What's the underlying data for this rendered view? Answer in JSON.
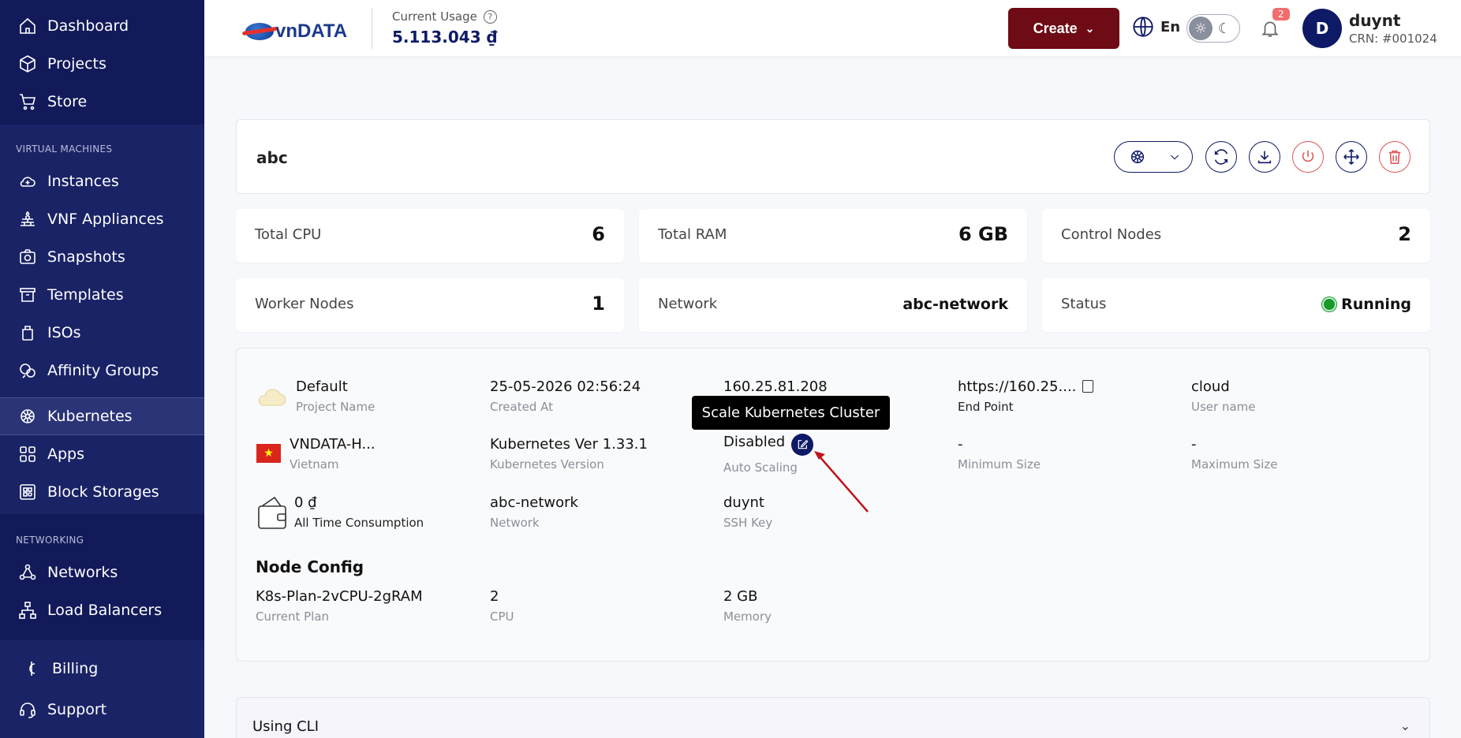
{
  "sidebar": {
    "top_items": [
      {
        "label": "Dashboard",
        "icon": "home-icon"
      },
      {
        "label": "Projects",
        "icon": "cube-icon"
      },
      {
        "label": "Store",
        "icon": "cart-icon"
      }
    ],
    "vm_section": "VIRTUAL MACHINES",
    "vm_items": [
      {
        "label": "Instances",
        "icon": "cloud-icon"
      },
      {
        "label": "VNF Appliances",
        "icon": "firewall-icon"
      },
      {
        "label": "Snapshots",
        "icon": "camera-icon"
      },
      {
        "label": "Templates",
        "icon": "archive-icon"
      },
      {
        "label": "ISOs",
        "icon": "disc-icon"
      },
      {
        "label": "Affinity Groups",
        "icon": "affinity-icon"
      },
      {
        "label": "Kubernetes",
        "icon": "kubernetes-icon"
      },
      {
        "label": "Apps",
        "icon": "apps-icon"
      },
      {
        "label": "Block Storages",
        "icon": "storage-icon"
      }
    ],
    "net_section": "NETWORKING",
    "net_items": [
      {
        "label": "Networks",
        "icon": "network-icon"
      },
      {
        "label": "Load Balancers",
        "icon": "load-balancer-icon"
      }
    ],
    "bottom_items": [
      {
        "label": "Billing",
        "icon": "billing-icon"
      },
      {
        "label": "Support",
        "icon": "headset-icon"
      }
    ]
  },
  "header": {
    "logo_text": "vnDATA",
    "usage_label": "Current Usage",
    "usage_value": "5.113.043 ₫",
    "create_label": "Create",
    "lang": "En",
    "notif_count": "2",
    "avatar_letter": "D",
    "user_name": "duynt",
    "crn": "CRN: #001024"
  },
  "cluster": {
    "name": "abc"
  },
  "stats": {
    "total_cpu_label": "Total CPU",
    "total_cpu": "6",
    "total_ram_label": "Total RAM",
    "total_ram": "6 GB",
    "control_nodes_label": "Control Nodes",
    "control_nodes": "2",
    "worker_nodes_label": "Worker Nodes",
    "worker_nodes": "1",
    "network_label": "Network",
    "network": "abc-network",
    "status_label": "Status",
    "status": "Running"
  },
  "details": {
    "project": {
      "value": "Default",
      "key": "Project Name"
    },
    "created": {
      "value": "25-05-2026 02:56:24",
      "key": "Created At"
    },
    "ip": {
      "value": "160.25.81.208"
    },
    "endpoint": {
      "value": "https://160.25....",
      "key": "End Point"
    },
    "user": {
      "value": "cloud",
      "key": "User name"
    },
    "zone": {
      "value": "VNDATA-H...",
      "key": "Vietnam"
    },
    "k8s_version": {
      "value": "Kubernetes Ver 1.33.1",
      "key": "Kubernetes Version"
    },
    "autoscale": {
      "value": "Disabled",
      "key": "Auto Scaling"
    },
    "min_size": {
      "value": "-",
      "key": "Minimum Size"
    },
    "max_size": {
      "value": "-",
      "key": "Maximum Size"
    },
    "consumption": {
      "value": "0 ₫",
      "key": "All Time Consumption"
    },
    "net": {
      "value": "abc-network",
      "key": "Network"
    },
    "ssh": {
      "value": "duynt",
      "key": "SSH Key"
    }
  },
  "node_config": {
    "title": "Node Config",
    "plan": {
      "value": "K8s-Plan-2vCPU-2gRAM",
      "key": "Current Plan"
    },
    "cpu": {
      "value": "2",
      "key": "CPU"
    },
    "memory": {
      "value": "2 GB",
      "key": "Memory"
    }
  },
  "tooltip": "Scale Kubernetes Cluster",
  "cli": {
    "title": "Using CLI"
  },
  "colors": {
    "sidebar": "#121a5a",
    "accent": "#0e1a66",
    "create": "#6e0b14",
    "running": "#1a9a2a"
  }
}
